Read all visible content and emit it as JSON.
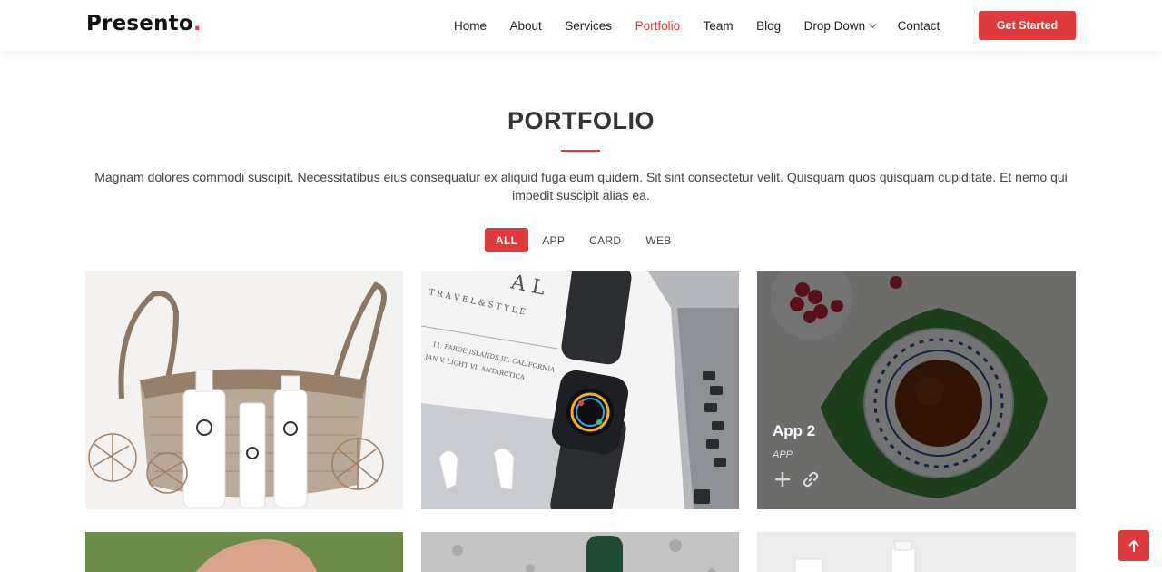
{
  "header": {
    "logo_text": "Presento",
    "logo_dot": ".",
    "nav": [
      {
        "label": "Home"
      },
      {
        "label": "About"
      },
      {
        "label": "Services"
      },
      {
        "label": "Portfolio",
        "active": true
      },
      {
        "label": "Team"
      },
      {
        "label": "Blog"
      },
      {
        "label": "Drop Down",
        "dropdown": true
      },
      {
        "label": "Contact"
      }
    ],
    "cta_label": "Get Started"
  },
  "portfolio": {
    "title": "PORTFOLIO",
    "description": "Magnam dolores commodi suscipit. Necessitatibus eius consequatur ex aliquid fuga eum quidem. Sit sint consectetur velit. Quisquam quos quisquam cupiditate. Et nemo qui impedit suscipit alias ea.",
    "filters": [
      {
        "label": "ALL",
        "active": true
      },
      {
        "label": "APP"
      },
      {
        "label": "CARD"
      },
      {
        "label": "WEB"
      }
    ],
    "hovered_item": {
      "title": "App 2",
      "category": "APP"
    },
    "items": [
      {
        "image": "basket-and-skincare-bottles"
      },
      {
        "image": "smartwatch-airpods-laptop"
      },
      {
        "image": "tea-cup-and-raspberries"
      },
      {
        "image": "hand-photo"
      },
      {
        "image": "green-bottle-on-granite"
      },
      {
        "image": "white-bottles"
      }
    ]
  },
  "icons": {
    "zoom": "plus-icon",
    "link": "link-icon",
    "back_to_top": "arrow-up-icon",
    "dropdown": "chevron-down-icon"
  },
  "colors": {
    "accent": "#e03a3c",
    "text": "#444444",
    "heading": "#333333"
  }
}
